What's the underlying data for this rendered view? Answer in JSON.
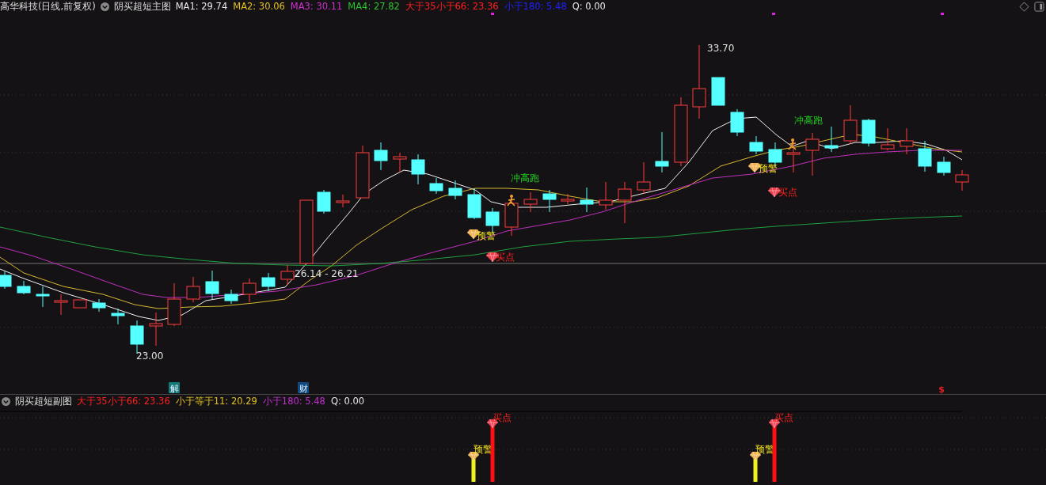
{
  "main_header": {
    "title": "高华科技(日线,前复权)",
    "indicator": "阴买超短主图",
    "values": [
      {
        "text": "MA1: 29.74",
        "color": "#e8e8e8"
      },
      {
        "text": "MA2: 30.06",
        "color": "#e0c020"
      },
      {
        "text": "MA3: 30.11",
        "color": "#d030d0"
      },
      {
        "text": "MA4: 27.82",
        "color": "#30c030"
      },
      {
        "text": "大于35小于66: 23.36",
        "color": "#ff2020"
      },
      {
        "text": "小于180: 5.48",
        "color": "#2020ff"
      },
      {
        "text": "Q: 0.00",
        "color": "#e8e8e8"
      }
    ]
  },
  "main_chart": {
    "price_labels": [
      "33.70",
      "23.00",
      "26.14 - 26.21"
    ],
    "signals": [
      {
        "kind": "run",
        "label": "冲高跑"
      },
      {
        "kind": "warn",
        "label": "预警"
      },
      {
        "kind": "buy",
        "label": "买点"
      },
      {
        "kind": "run",
        "label": "冲高跑"
      },
      {
        "kind": "warn",
        "label": "预警"
      },
      {
        "kind": "buy",
        "label": "买点"
      }
    ],
    "events": [
      {
        "label": "解",
        "color": "#107878"
      },
      {
        "label": "财",
        "color": "#104a80"
      },
      {
        "label": "$",
        "color": "#e02020"
      }
    ]
  },
  "sub_header": {
    "indicator": "阴买超短副图",
    "values": [
      {
        "text": "大于35小于66: 23.36",
        "color": "#ff2020"
      },
      {
        "text": "小于等于11: 20.29",
        "color": "#e0c020"
      },
      {
        "text": "小于180: 5.48",
        "color": "#c030d0"
      },
      {
        "text": "Q: 0.00",
        "color": "#e8e8e8"
      }
    ]
  },
  "sub_chart": {
    "signals": [
      {
        "kind": "warn",
        "label": "预警"
      },
      {
        "kind": "buy",
        "label": "买点"
      },
      {
        "kind": "warn",
        "label": "预警"
      },
      {
        "kind": "buy",
        "label": "买点"
      }
    ]
  }
}
